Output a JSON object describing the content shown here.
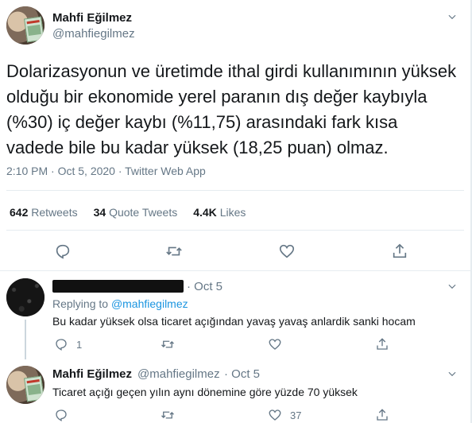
{
  "main_tweet": {
    "author_name": "Mahfi Eğilmez",
    "author_handle": "@mahfiegilmez",
    "text": "Dolarizasyonun ve üretimde ithal girdi kullanımının yüksek olduğu bir ekonomide yerel paranın dış değer kaybıyla (%30) iç değer kaybı (%11,75) arasındaki fark kısa vadede bile bu kadar yüksek (18,25 puan) olmaz.",
    "meta": "2:10 PM · Oct 5, 2020 · Twitter Web App",
    "stats": {
      "retweets_count": "642",
      "retweets_label": "Retweets",
      "quote_count": "34",
      "quote_label": "Quote Tweets",
      "likes_count": "4.4K",
      "likes_label": "Likes"
    },
    "icons": [
      "reply-icon",
      "retweet-icon",
      "like-icon",
      "share-icon",
      "chevron-down-icon"
    ]
  },
  "replies": [
    {
      "author_name": "",
      "date": "· Oct 5",
      "replying_prefix": "Replying to",
      "replying_to": "@mahfiegilmez",
      "text": "Bu kadar yüksek olsa ticaret açığından yavaş yavaş anlardik sanki hocam",
      "reply_count": "1",
      "like_count": ""
    },
    {
      "author_name": "Mahfi Eğilmez",
      "author_handle": "@mahfiegilmez",
      "date": "· Oct 5",
      "text": "Ticaret açığı geçen yılın aynı dönemine göre yüzde 70 yüksek",
      "reply_count": "",
      "like_count": "37"
    }
  ],
  "colors": {
    "text": "#14171a",
    "secondary": "#657786",
    "link": "#1b95e0",
    "divider": "#e6ecf0"
  }
}
